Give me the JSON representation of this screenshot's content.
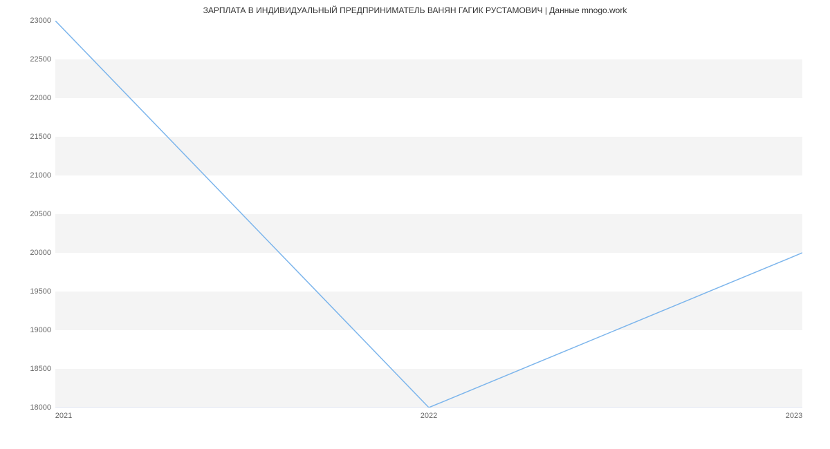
{
  "chart_data": {
    "type": "line",
    "title": "ЗАРПЛАТА В ИНДИВИДУАЛЬНЫЙ ПРЕДПРИНИМАТЕЛЬ ВАНЯН ГАГИК РУСТАМОВИЧ | Данные mnogo.work",
    "xlabel": "",
    "ylabel": "",
    "x": [
      2021,
      2022,
      2023
    ],
    "values": [
      23000,
      18000,
      20000
    ],
    "xlim": [
      2021,
      2023
    ],
    "ylim": [
      18000,
      23000
    ],
    "y_ticks": [
      18000,
      18500,
      19000,
      19500,
      20000,
      20500,
      21000,
      21500,
      22000,
      22500,
      23000
    ],
    "x_ticks": [
      2021,
      2022,
      2023
    ],
    "grid": true
  }
}
